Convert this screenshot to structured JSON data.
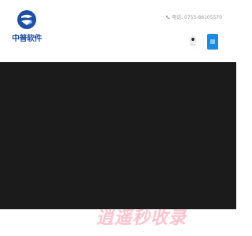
{
  "header": {
    "logo_text": "中普软件",
    "phone_text": "电话: 0755-86105570",
    "menu_icon": "hamburger-menu-icon",
    "brand_color": "#1f4fa3",
    "menu_button_color": "#1a8be0"
  },
  "hero": {
    "background_color": "#1b1b1b"
  },
  "watermark": {
    "text": "逍遥秒收录",
    "color": "#ff2a55"
  }
}
